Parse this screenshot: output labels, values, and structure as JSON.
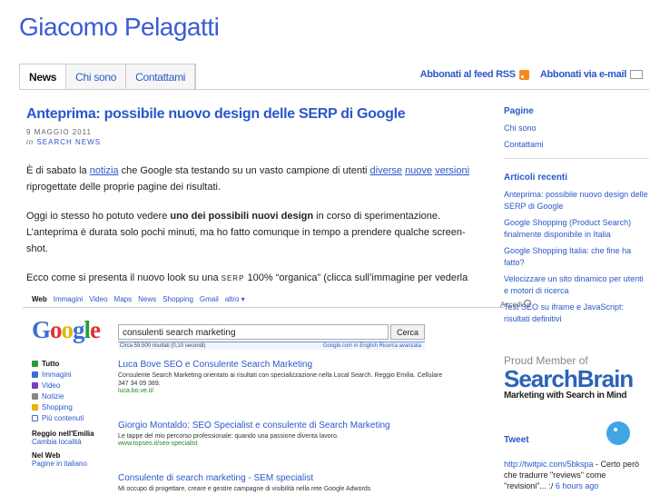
{
  "site": {
    "title": "Giacomo Pelagatti"
  },
  "nav": {
    "tabs": [
      "News",
      "Chi sono",
      "Contattami"
    ]
  },
  "feeds": {
    "rss": "Abbonati al feed RSS",
    "email": "Abbonati via e-mail"
  },
  "post": {
    "title": "Anteprima: possibile nuovo design delle SERP di Google",
    "date": "9 MAGGIO 2011",
    "in": "in",
    "category": "SEARCH NEWS",
    "p1": {
      "a": "È di sabato la ",
      "link1": "notizia",
      "b": " che Google sta testando su un vasto campione di utenti ",
      "link2": "diverse",
      "link3": "nuove",
      "link4": "versioni",
      "c": " riprogettate delle proprie pagine dei risultati."
    },
    "p2": {
      "a": "Oggi io stesso ho potuto vedere ",
      "bold": "uno dei possibili nuovi design",
      "b": " in corso di sperimentazione. L’anteprima è durata solo pochi minuti, ma ho fatto comunque in tempo a prendere qualche screen-shot."
    },
    "p3": {
      "a": "Ecco come si presenta il nuovo look su una ",
      "serp": "SERP",
      "b": " 100% “organica” (clicca sull’immagine per vederla per intero in scala 1:1):"
    }
  },
  "sidebar": {
    "pages_heading": "Pagine",
    "pages": [
      "Chi sono",
      "Contattami"
    ],
    "recent_heading": "Articoli recenti",
    "recent": [
      "Anteprima: possibile nuovo design delle SERP di Google",
      "Google Shopping (Product Search) finalmente disponibile in Italia",
      "Google Shopping Italia: che fine ha fatto?",
      "Velocizzare un sito dinamico per utenti e motori di ricerca",
      "Test SEO su iframe e JavaScript: risultati definitivi"
    ],
    "badge": {
      "top": "Proud Member of",
      "name": "SearchBrain",
      "tagline": "Marketing with Search in Mind"
    },
    "tweet_heading": "Tweet",
    "tweet": {
      "link": "http://twitpic.com/5bkspa",
      "text": " - Certo però che tradurre \"reviews\" come \"revisioni\"... :/ ",
      "time": "6 hours ago"
    }
  },
  "google": {
    "topbar": [
      "Web",
      "Immagini",
      "Video",
      "Maps",
      "News",
      "Shopping",
      "Gmail",
      "altro ▾"
    ],
    "accedi": "Accedi",
    "query": "consulenti search marketing",
    "button": "Cerca",
    "stats": "Circa 59.500 risultati (0,10 secondi)",
    "stats_right": "Google.com in English   Ricerca avanzata",
    "side_items": [
      "Tutto",
      "Immagini",
      "Video",
      "Notizie",
      "Shopping",
      "Più contenuti"
    ],
    "side_colors": [
      "#2a9a3a",
      "#3b6fd6",
      "#7b3fb8",
      "#888888",
      "#e7b30e",
      "#3b6fd6"
    ],
    "region_h": "Reggio nell'Emilia",
    "region_s": "Cambia località",
    "web_h": "Nel Web",
    "web_s": "Pagine in italiano",
    "results": [
      {
        "title": "Luca Bove SEO e Consulente Search Marketing",
        "desc": "Consulente Search Marketing orientato ai risultati con specializzazione nella Local Search. Reggio Emilia. Cellulare 347 34 09 389.",
        "url": "luca.bo.ve.it/"
      },
      {
        "title": "Giorgio Montaldo: SEO Specialist e consulente di Search Marketing",
        "desc": "Le tappe del mio percorso professionale: quando una passione diventa lavoro.",
        "url": "www.topseo.it/seo-specialist"
      },
      {
        "title": "Consulente di search marketing - SEM specialist",
        "desc": "Mi occupo di progettare, creare e gestire campagne di visibilità nella rete Google Adwords",
        "url": ""
      }
    ]
  }
}
